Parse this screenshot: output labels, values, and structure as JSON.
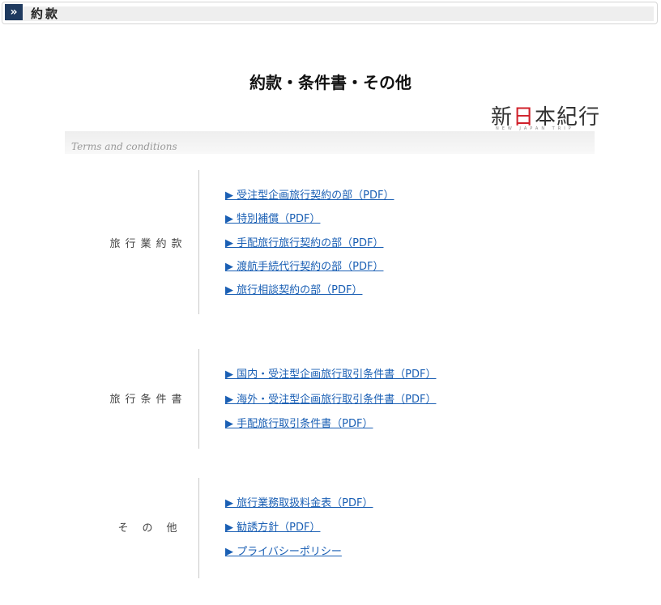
{
  "header": {
    "title": "約款",
    "chevron": "»"
  },
  "page_title": "約款・条件書・その他",
  "logo": {
    "main_pre": "新",
    "main_red": "日",
    "main_post": "本紀行",
    "sub": "NEW JAPAN TRIP"
  },
  "terms_band": "Terms and conditions",
  "sections": [
    {
      "label": "旅行業約款",
      "links": [
        "▶ 受注型企画旅行契約の部（PDF）",
        "▶ 特別補償（PDF）",
        "▶ 手配旅行旅行契約の部（PDF）",
        "▶ 渡航手続代行契約の部（PDF）",
        "▶ 旅行相談契約の部（PDF）"
      ]
    },
    {
      "label": "旅行条件書",
      "links": [
        "▶ 国内・受注型企画旅行取引条件書（PDF）",
        "▶ 海外・受注型企画旅行取引条件書（PDF）",
        "▶ 手配旅行取引条件書（PDF）"
      ]
    },
    {
      "label": "そ　の　他",
      "links": [
        "▶ 旅行業務取扱料金表（PDF）",
        "▶ 勧誘方針（PDF）",
        "▶ プライバシーポリシー"
      ]
    }
  ]
}
